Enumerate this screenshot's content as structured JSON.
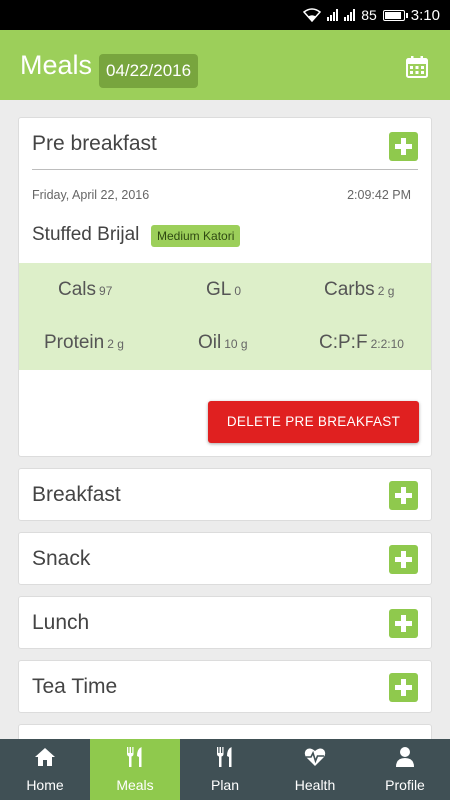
{
  "status_bar": {
    "battery": "85",
    "time": "3:10"
  },
  "app_bar": {
    "title": "Meals",
    "date": "04/22/2016",
    "calendar_icon": "calendar-icon"
  },
  "meals": [
    {
      "name": "Pre breakfast",
      "expanded": true,
      "entry": {
        "date": "Friday, April 22, 2016",
        "time": "2:09:42 PM",
        "food": "Stuffed Brijal",
        "portion": "Medium Katori",
        "nutrition": {
          "cals": {
            "label": "Cals",
            "value": "97"
          },
          "gl": {
            "label": "GL",
            "value": "0"
          },
          "carbs": {
            "label": "Carbs",
            "value": "2 g"
          },
          "protein": {
            "label": "Protein",
            "value": "2 g"
          },
          "oil": {
            "label": "Oil",
            "value": "10 g"
          },
          "cpf": {
            "label": "C:P:F",
            "value": "2:2:10"
          }
        }
      },
      "delete_label": "DELETE PRE BREAKFAST"
    },
    {
      "name": "Breakfast"
    },
    {
      "name": "Snack"
    },
    {
      "name": "Lunch"
    },
    {
      "name": "Tea Time"
    }
  ],
  "bottom_nav": {
    "active": "Meals",
    "tabs": [
      {
        "label": "Home",
        "icon": "home-icon"
      },
      {
        "label": "Meals",
        "icon": "fork-knife-icon"
      },
      {
        "label": "Plan",
        "icon": "fork-knife-icon"
      },
      {
        "label": "Health",
        "icon": "heart-pulse-icon"
      },
      {
        "label": "Profile",
        "icon": "person-icon"
      }
    ]
  },
  "colors": {
    "brand_green": "#9ccf5a",
    "plus_green": "#8fc94d",
    "date_chip": "#78a53e",
    "nutrition_bg": "#ddefc9",
    "delete_red": "#e02020",
    "nav_bg": "#405055"
  }
}
